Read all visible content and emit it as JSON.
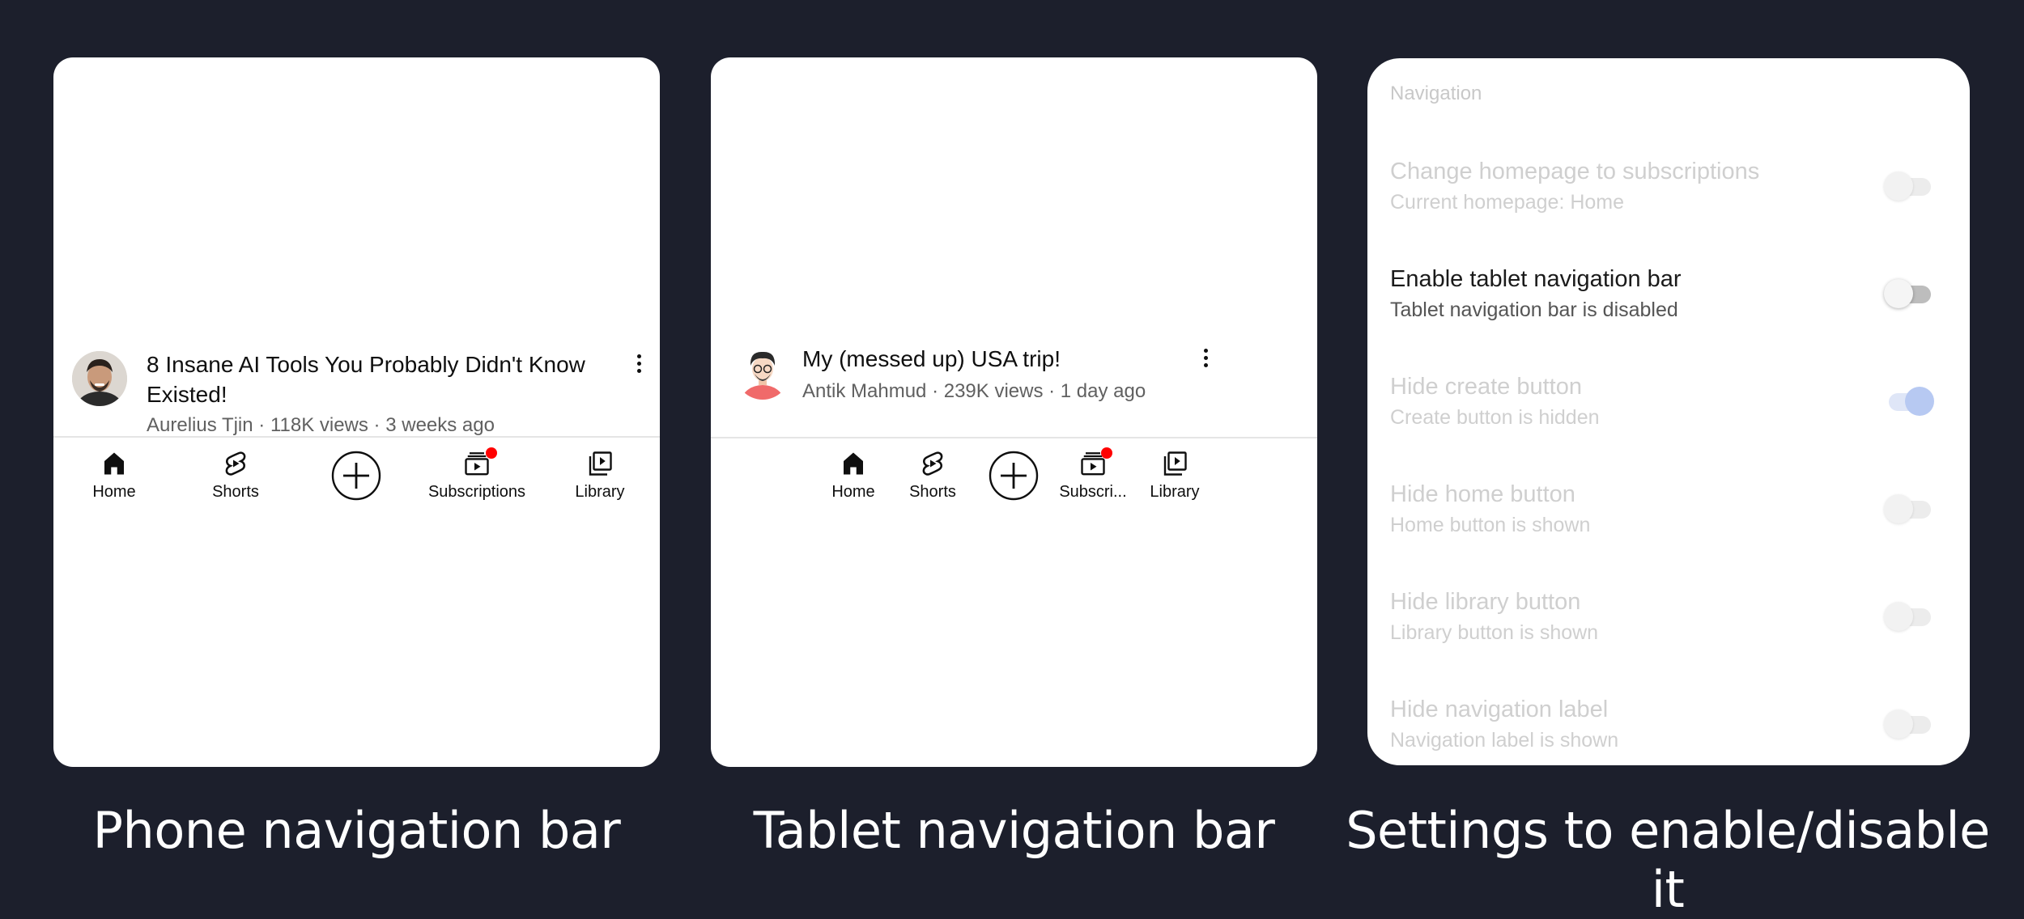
{
  "phone": {
    "video": {
      "title": "8 Insane AI Tools You Probably Didn't Know Existed!",
      "meta": "Aurelius Tjin · 118K views · 3 weeks ago"
    },
    "nav": [
      {
        "label": "Home",
        "icon": "home-icon"
      },
      {
        "label": "Shorts",
        "icon": "shorts-icon"
      },
      {
        "label": "",
        "icon": "create-icon"
      },
      {
        "label": "Subscriptions",
        "icon": "subscriptions-icon"
      },
      {
        "label": "Library",
        "icon": "library-icon"
      }
    ],
    "caption": "Phone navigation bar"
  },
  "tablet": {
    "video": {
      "title": "My (messed up) USA trip!",
      "meta": "Antik Mahmud · 239K views · 1 day ago"
    },
    "nav": [
      {
        "label": "Home",
        "icon": "home-icon"
      },
      {
        "label": "Shorts",
        "icon": "shorts-icon"
      },
      {
        "label": "",
        "icon": "create-icon"
      },
      {
        "label": "Subscri...",
        "icon": "subscriptions-icon"
      },
      {
        "label": "Library",
        "icon": "library-icon"
      }
    ],
    "caption": "Tablet navigation bar"
  },
  "settings": {
    "header": "Navigation",
    "rows": [
      {
        "title": "Change homepage to subscriptions",
        "subtitle": "Current homepage: Home",
        "enabled": false,
        "active": false
      },
      {
        "title": "Enable tablet navigation bar",
        "subtitle": "Tablet navigation bar is disabled",
        "enabled": false,
        "active": true
      },
      {
        "title": "Hide create button",
        "subtitle": "Create button is hidden",
        "enabled": true,
        "active": false
      },
      {
        "title": "Hide home button",
        "subtitle": "Home button is shown",
        "enabled": false,
        "active": false
      },
      {
        "title": "Hide library button",
        "subtitle": "Library button is shown",
        "enabled": false,
        "active": false
      },
      {
        "title": "Hide navigation label",
        "subtitle": "Navigation label is shown",
        "enabled": false,
        "active": false
      }
    ],
    "caption": "Settings to enable/disable it"
  },
  "colors": {
    "background": "#1c1f2c",
    "badge": "#ff0000",
    "toggle_on": "#b7c9f2"
  }
}
